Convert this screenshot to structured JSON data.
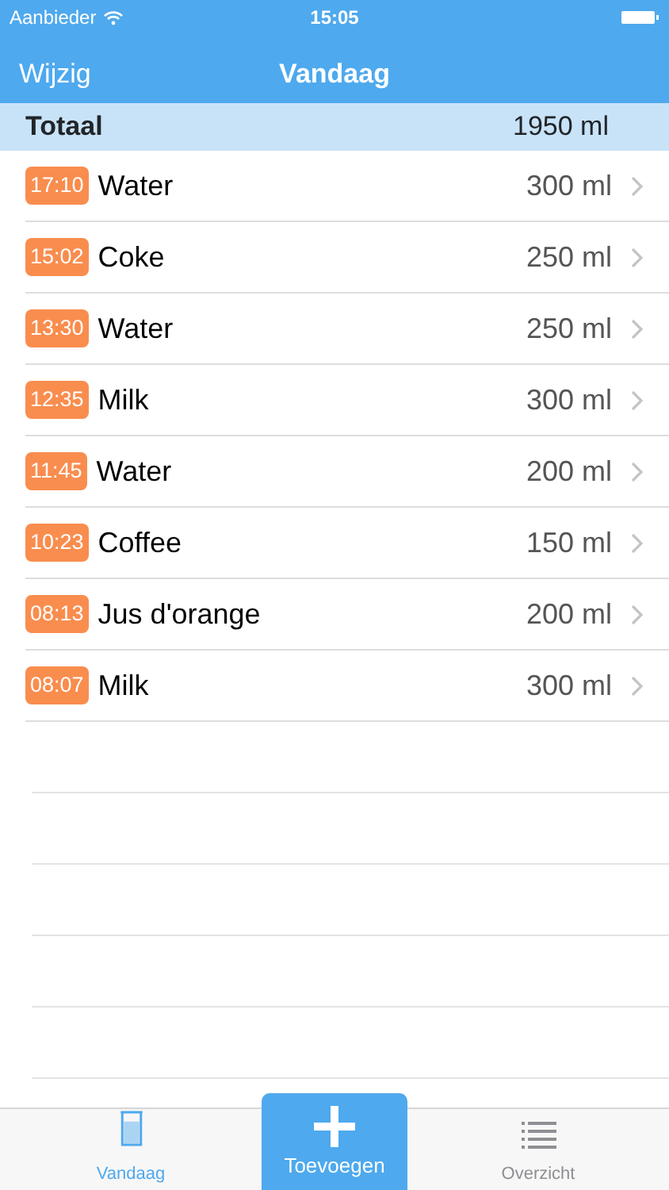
{
  "status_bar": {
    "carrier": "Aanbieder",
    "time": "15:05"
  },
  "nav_bar": {
    "left_button": "Wijzig",
    "title": "Vandaag"
  },
  "total": {
    "label": "Totaal",
    "amount": "1950 ml"
  },
  "entries": [
    {
      "time": "17:10",
      "drink": "Water",
      "amount": "300 ml"
    },
    {
      "time": "15:02",
      "drink": "Coke",
      "amount": "250 ml"
    },
    {
      "time": "13:30",
      "drink": "Water",
      "amount": "250 ml"
    },
    {
      "time": "12:35",
      "drink": "Milk",
      "amount": "300 ml"
    },
    {
      "time": "11:45",
      "drink": "Water",
      "amount": "200 ml"
    },
    {
      "time": "10:23",
      "drink": "Coffee",
      "amount": "150 ml"
    },
    {
      "time": "08:13",
      "drink": "Jus d'orange",
      "amount": "200 ml"
    },
    {
      "time": "08:07",
      "drink": "Milk",
      "amount": "300 ml"
    }
  ],
  "tab_bar": [
    {
      "kind": "tab",
      "label": "Vandaag",
      "selected": true
    },
    {
      "kind": "add",
      "label": "Toevoegen"
    },
    {
      "kind": "tab",
      "label": "Overzicht",
      "selected": false
    }
  ]
}
